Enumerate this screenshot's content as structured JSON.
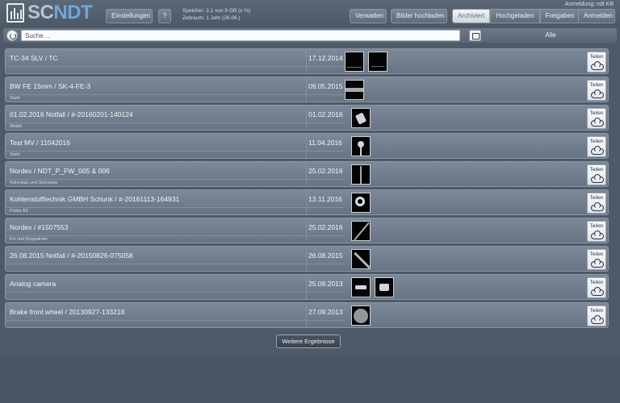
{
  "header": {
    "logo_sc": "SC",
    "logo_ndt": "NDT",
    "settings_label": "Einstellungen",
    "help_label": "?",
    "storage_line1": "Speicher: 2,1 von 9 GB (x %)",
    "storage_line2": "Zeitraum: 1 Jahr (26.06.)",
    "manage_label": "Verwalten",
    "upload_label": "Bilder hochladen",
    "tabs": [
      {
        "label": "Archiviert",
        "active": true
      },
      {
        "label": "Hochgeladen",
        "active": false
      },
      {
        "label": "Freigaben",
        "active": false
      }
    ],
    "login_label": "Anmelden",
    "user_line": "Anmeldung: ndt KB"
  },
  "search": {
    "placeholder": "Suche ...",
    "filter_label": "Alle"
  },
  "items": [
    {
      "title": "TC-34 SLV / TC",
      "subtitle": "",
      "date": "17.12.2014",
      "thumbs": 2,
      "share_label": "Teilen"
    },
    {
      "title": "BW FE 15mm / SK-4-FE-3",
      "subtitle": "Stahl",
      "date": "09.05.2015",
      "thumbs": 1,
      "share_label": "Teilen"
    },
    {
      "title": "01.02.2016 Notfall / #-20160201-140124",
      "subtitle": "Metall",
      "date": "01.02.2016",
      "thumbs": 1,
      "share_label": "Teilen"
    },
    {
      "title": "Test MV / 11042016",
      "subtitle": "Stahl",
      "date": "11.04.2016",
      "thumbs": 1,
      "share_label": "Teilen"
    },
    {
      "title": "Nordex / NDT_P_FW_005 & 006",
      "subtitle": "Rohrstutz und Schraube",
      "date": "25.02.2016",
      "thumbs": 1,
      "share_label": "Teilen"
    },
    {
      "title": "Kohlenstofftechnik GMBH Schunk / #-20161113-164931",
      "subtitle": "Probe A3",
      "date": "13.11.2016",
      "thumbs": 1,
      "share_label": "Teilen"
    },
    {
      "title": "Nordex / #1507553",
      "subtitle": "KS und Doppelrohr",
      "date": "25.02.2016",
      "thumbs": 1,
      "share_label": "Teilen"
    },
    {
      "title": "26.08.2015 Notfall / #-20150826-075058",
      "subtitle": "",
      "date": "26.08.2015",
      "thumbs": 1,
      "share_label": "Teilen"
    },
    {
      "title": "Analog camera",
      "subtitle": "",
      "date": "25.09.2013",
      "thumbs": 2,
      "share_label": "Teilen"
    },
    {
      "title": "Brake front wheel / 20130927-133218",
      "subtitle": "",
      "date": "27.09.2013",
      "thumbs": 1,
      "share_label": "Teilen"
    }
  ],
  "more_results_label": "Weitere Ergebnisse"
}
